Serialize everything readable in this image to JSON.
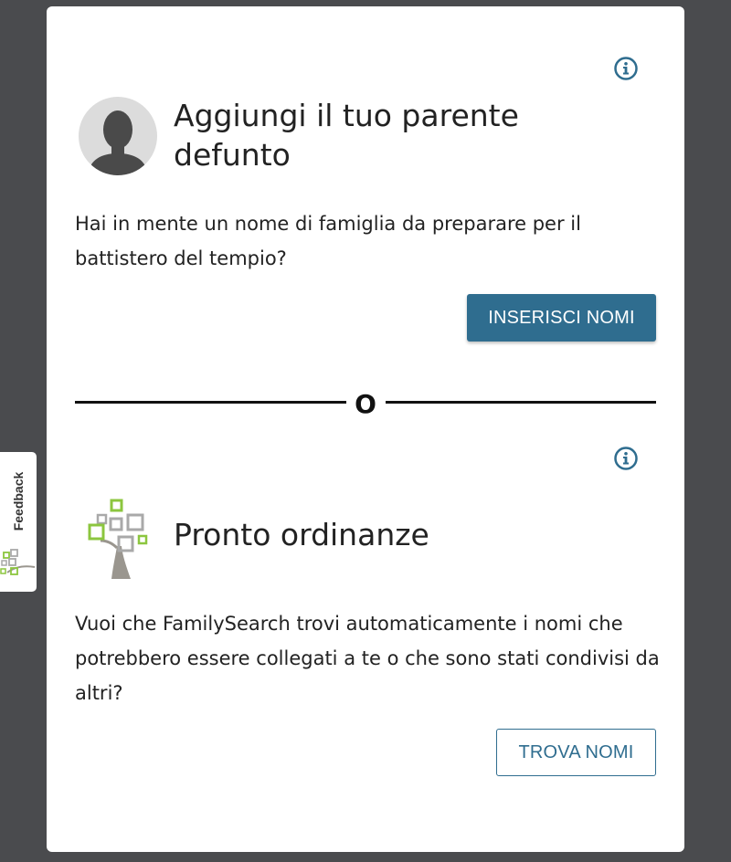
{
  "section1": {
    "title": "Aggiungi il tuo parente defunto",
    "description": "Hai in mente un nome di famiglia da preparare per il battistero del tempio?",
    "button_label": "INSERISCI NOMI"
  },
  "divider": {
    "label": "O"
  },
  "section2": {
    "title": "Pronto ordinanze",
    "description": "Vuoi che FamilySearch trovi automaticamente i nomi che potrebbero essere collegati a te o che sono stati condivisi da altri?",
    "button_label": "TROVA NOMI"
  },
  "feedback": {
    "label": "Feedback"
  },
  "colors": {
    "primary": "#2f6d8f",
    "background": "#4a4b4e",
    "card": "#ffffff",
    "tree_green": "#8cc63f",
    "tree_gray": "#a9a9a9"
  }
}
